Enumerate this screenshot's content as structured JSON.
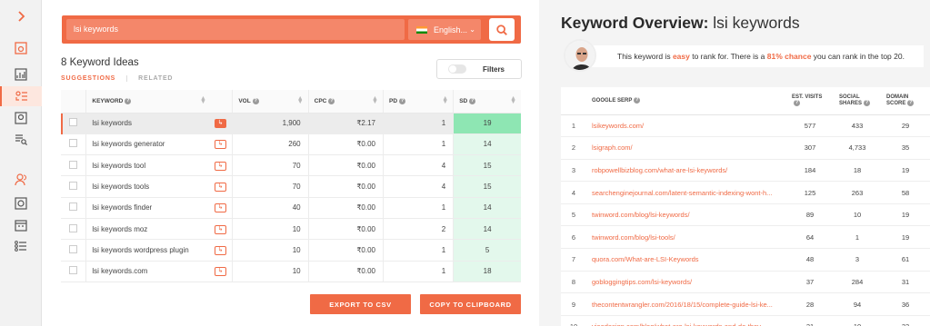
{
  "rail": {
    "items": [
      "expand-chevron-icon",
      "overview-icon",
      "chart-icon",
      "keyword-ideas-icon",
      "content-ideas-icon",
      "site-audit-icon",
      "users-icon",
      "top-pages-icon",
      "calendar-icon",
      "list-icon"
    ]
  },
  "search": {
    "value": "lsi keywords",
    "language": "English...",
    "button_icon": "search-icon"
  },
  "ideas": {
    "title": "8 Keyword Ideas",
    "tab_suggestions": "SUGGESTIONS",
    "tab_related": "RELATED",
    "filters_label": "Filters",
    "columns": [
      "KEYWORD",
      "VOL",
      "CPC",
      "PD",
      "SD"
    ],
    "rows": [
      {
        "keyword": "lsi keywords",
        "vol": "1,900",
        "cpc": "₹2.17",
        "pd": "1",
        "sd": "19"
      },
      {
        "keyword": "lsi keywords generator",
        "vol": "260",
        "cpc": "₹0.00",
        "pd": "1",
        "sd": "14"
      },
      {
        "keyword": "lsi keywords tool",
        "vol": "70",
        "cpc": "₹0.00",
        "pd": "4",
        "sd": "15"
      },
      {
        "keyword": "lsi keywords tools",
        "vol": "70",
        "cpc": "₹0.00",
        "pd": "4",
        "sd": "15"
      },
      {
        "keyword": "lsi keywords finder",
        "vol": "40",
        "cpc": "₹0.00",
        "pd": "1",
        "sd": "14"
      },
      {
        "keyword": "lsi keywords moz",
        "vol": "10",
        "cpc": "₹0.00",
        "pd": "2",
        "sd": "14"
      },
      {
        "keyword": "lsi keywords wordpress plugin",
        "vol": "10",
        "cpc": "₹0.00",
        "pd": "1",
        "sd": "5"
      },
      {
        "keyword": "lsi keywords.com",
        "vol": "10",
        "cpc": "₹0.00",
        "pd": "1",
        "sd": "18"
      }
    ],
    "export_csv": "EXPORT TO CSV",
    "copy_clipboard": "COPY TO CLIPBOARD"
  },
  "overview": {
    "title_prefix": "Keyword Overview:",
    "keyword": "lsi keywords",
    "msg_1": "This keyword is ",
    "msg_easy": "easy",
    "msg_2": " to rank for. There is a ",
    "msg_chance": "81% chance",
    "msg_3": " you can rank in the top 20.",
    "serp_columns": {
      "serp": "GOOGLE SERP",
      "visits": "EST. VISITS",
      "shares": "SOCIAL SHARES",
      "score": "DOMAIN SCORE"
    },
    "serp_rows": [
      {
        "n": "1",
        "url": "lsikeywords.com/",
        "visits": "577",
        "shares": "433",
        "score": "29"
      },
      {
        "n": "2",
        "url": "lsigraph.com/",
        "visits": "307",
        "shares": "4,733",
        "score": "35"
      },
      {
        "n": "3",
        "url": "robpowellbizblog.com/what-are-lsi-keywords/",
        "visits": "184",
        "shares": "18",
        "score": "19"
      },
      {
        "n": "4",
        "url": "searchenginejournal.com/latent-semantic-indexing-wont-h...",
        "visits": "125",
        "shares": "263",
        "score": "58"
      },
      {
        "n": "5",
        "url": "twinword.com/blog/lsi-keywords/",
        "visits": "89",
        "shares": "10",
        "score": "19"
      },
      {
        "n": "6",
        "url": "twinword.com/blog/lsi-tools/",
        "visits": "64",
        "shares": "1",
        "score": "19"
      },
      {
        "n": "7",
        "url": "quora.com/What-are-LSI-Keywords",
        "visits": "48",
        "shares": "3",
        "score": "61"
      },
      {
        "n": "8",
        "url": "gobloggingtips.com/lsi-keywords/",
        "visits": "37",
        "shares": "284",
        "score": "31"
      },
      {
        "n": "9",
        "url": "thecontentwrangler.com/2016/18/15/complete-guide-lsi-ke...",
        "visits": "28",
        "shares": "94",
        "score": "36"
      },
      {
        "n": "10",
        "url": "vieodesign.com/blog/what-are-lsi-keywords-and-do-they-...",
        "visits": "21",
        "shares": "10",
        "score": "33"
      }
    ]
  },
  "colors": {
    "accent": "#f06a45",
    "sd_easy": "#8ee6b3",
    "sd_light": "#e3f8ec"
  }
}
